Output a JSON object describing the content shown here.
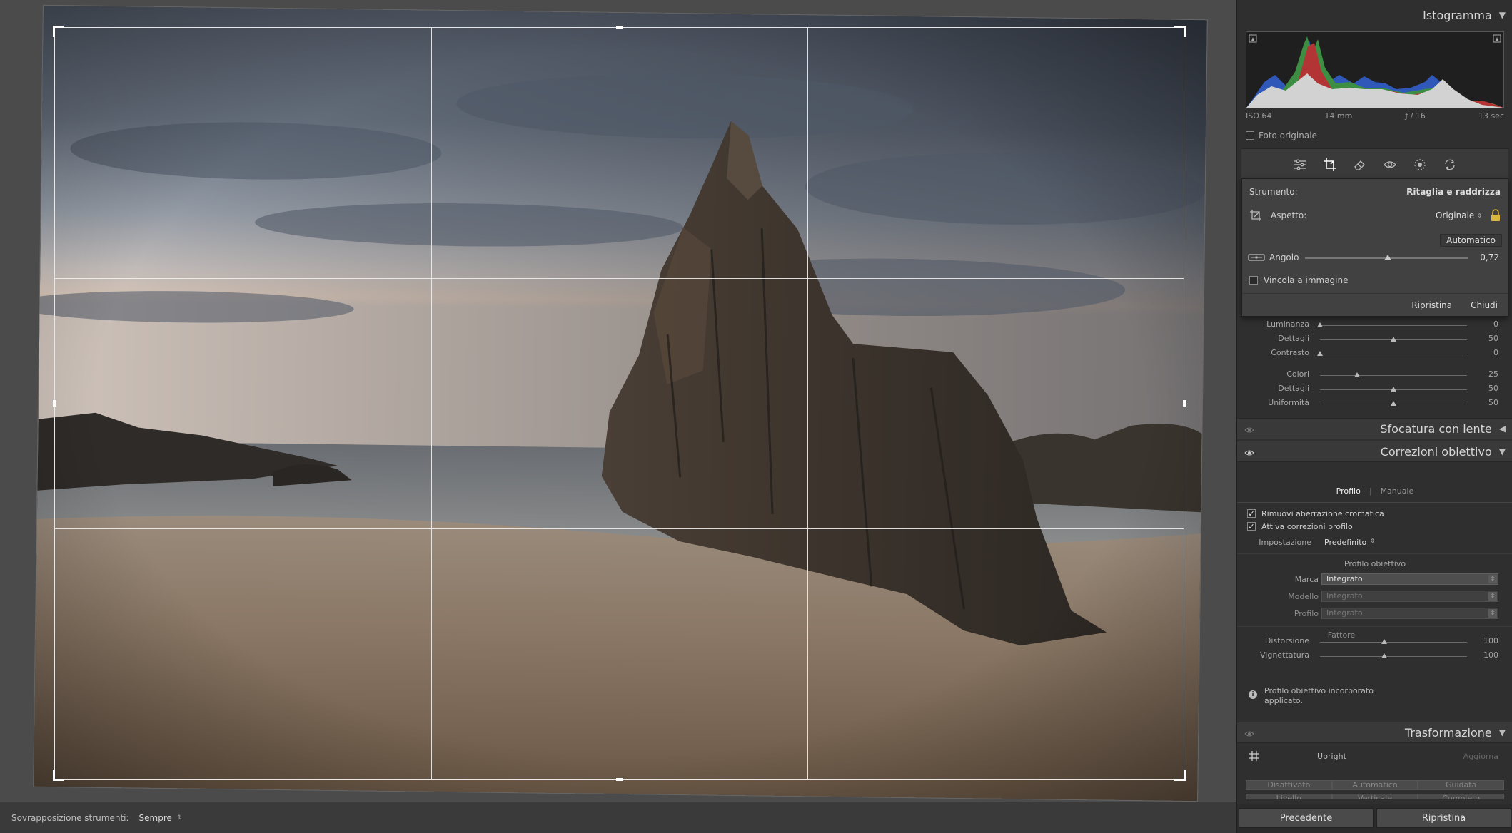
{
  "canvas": {
    "overlay_label": "Sovrapposizione strumenti:",
    "overlay_value": "Sempre"
  },
  "histogram": {
    "title": "Istogramma",
    "iso": "ISO 64",
    "focal": "14 mm",
    "aperture": "ƒ / 16",
    "shutter": "13 sec",
    "original_photo": "Foto originale"
  },
  "crop_tool": {
    "tool_label": "Strumento:",
    "tool_name": "Ritaglia e raddrizza",
    "aspect_label": "Aspetto:",
    "aspect_value": "Originale",
    "auto_button": "Automatico",
    "angle_label": "Angolo",
    "angle_value": "0,72",
    "angle_range": [
      -45,
      45
    ],
    "constrain_label": "Vincola a immagine",
    "reset_button": "Ripristina",
    "close_button": "Chiudi"
  },
  "detail_rows": [
    {
      "label": "Luminanza",
      "value": "0",
      "pos": 0.0
    },
    {
      "label": "Dettagli",
      "value": "50",
      "pos": 0.5
    },
    {
      "label": "Contrasto",
      "value": "0",
      "pos": 0.0
    },
    {
      "label": "Colori",
      "value": "25",
      "pos": 0.25
    },
    {
      "label": "Dettagli",
      "value": "50",
      "pos": 0.5
    },
    {
      "label": "Uniformità",
      "value": "50",
      "pos": 0.5
    }
  ],
  "lens_blur": {
    "title": "Sfocatura con lente"
  },
  "lens_corrections": {
    "title": "Correzioni obiettivo",
    "tab_profile": "Profilo",
    "tab_manual": "Manuale",
    "remove_ca": "Rimuovi aberrazione cromatica",
    "enable_profile": "Attiva correzioni profilo",
    "setup_label": "Impostazione",
    "setup_value": "Predefinito",
    "profile_section": "Profilo obiettivo",
    "make_label": "Marca",
    "make_value": "Integrato",
    "model_label": "Modello",
    "model_value": "Integrato",
    "profile_label": "Profilo",
    "profile_value": "Integrato",
    "amount_section": "Fattore",
    "distortion_label": "Distorsione",
    "distortion_value": "100",
    "vignetting_label": "Vignettatura",
    "vignetting_value": "100",
    "info_text_1": "Profilo obiettivo incorporato",
    "info_text_2": "applicato."
  },
  "transform": {
    "title": "Trasformazione",
    "upright": "Upright",
    "update": "Aggiorna",
    "buttons": [
      "Disattivato",
      "Automatico",
      "Guidata"
    ],
    "buttons_row2": [
      "Livello",
      "Verticale",
      "Completo"
    ]
  },
  "footer": {
    "previous": "Precedente",
    "reset": "Ripristina"
  }
}
